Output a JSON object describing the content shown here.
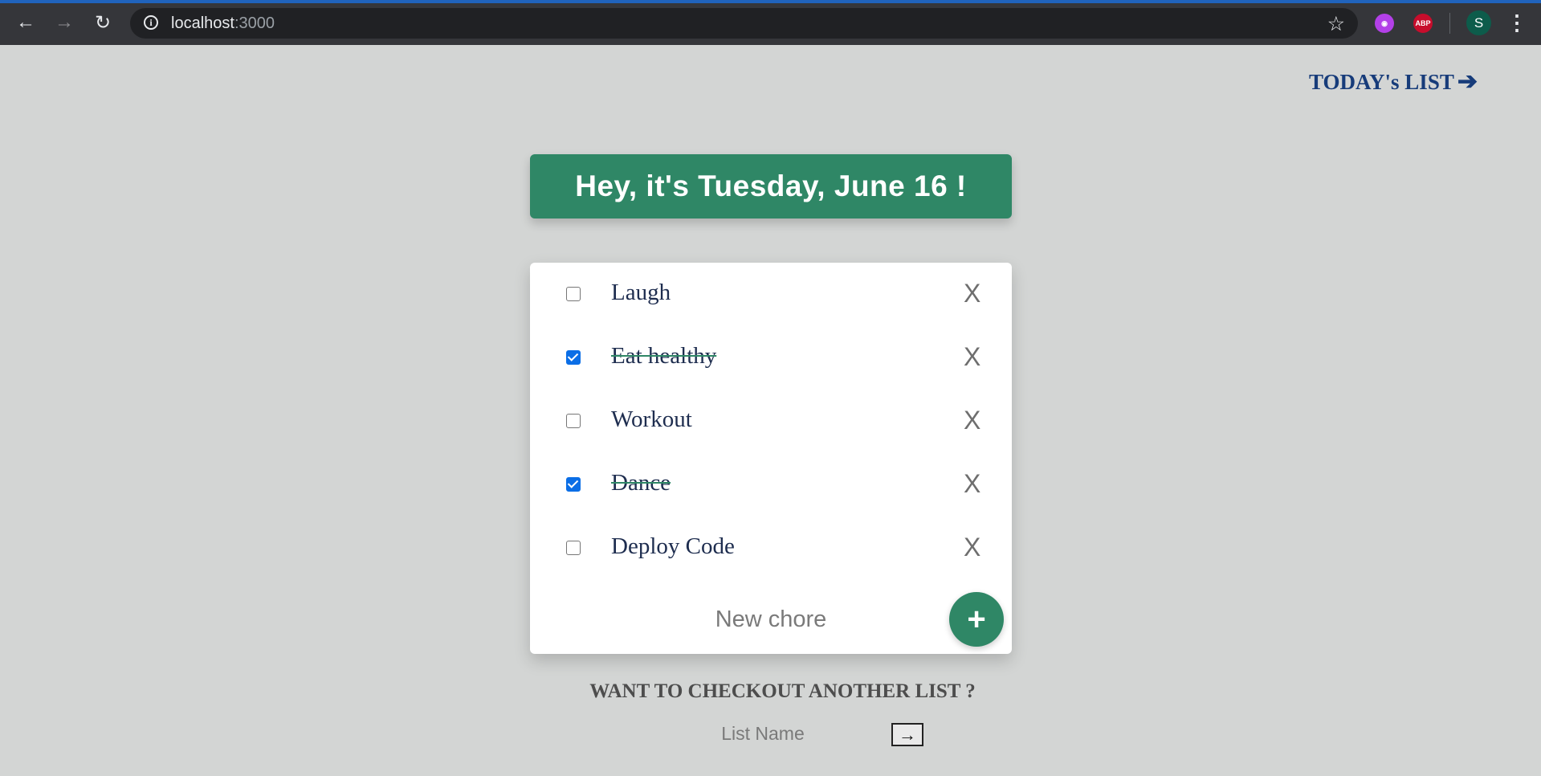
{
  "browser": {
    "url_host": "localhost",
    "url_port": ":3000",
    "ext_purple_icon": "extension-icon",
    "ext_abp_label": "ABP",
    "profile_initial": "S"
  },
  "header": {
    "todays_list_label": "TODAY's LIST",
    "arrow_glyph": "🡒"
  },
  "banner": {
    "date_text": "Hey, it's Tuesday, June 16 !"
  },
  "chores": [
    {
      "label": "Laugh",
      "checked": false
    },
    {
      "label": "Eat healthy",
      "checked": true
    },
    {
      "label": "Workout",
      "checked": false
    },
    {
      "label": "Dance",
      "checked": true
    },
    {
      "label": "Deploy Code",
      "checked": false
    }
  ],
  "delete_label": "X",
  "new_chore": {
    "placeholder": "New chore",
    "add_symbol": "+"
  },
  "another_list": {
    "title": "WANT TO CHECKOUT ANOTHER LIST ?",
    "placeholder": "List Name",
    "go_symbol": "→"
  },
  "colors": {
    "page_bg": "#d3d5d4",
    "accent_green": "#2f8766",
    "link_blue": "#173c7a",
    "checkbox_blue": "#0b6ee6"
  }
}
